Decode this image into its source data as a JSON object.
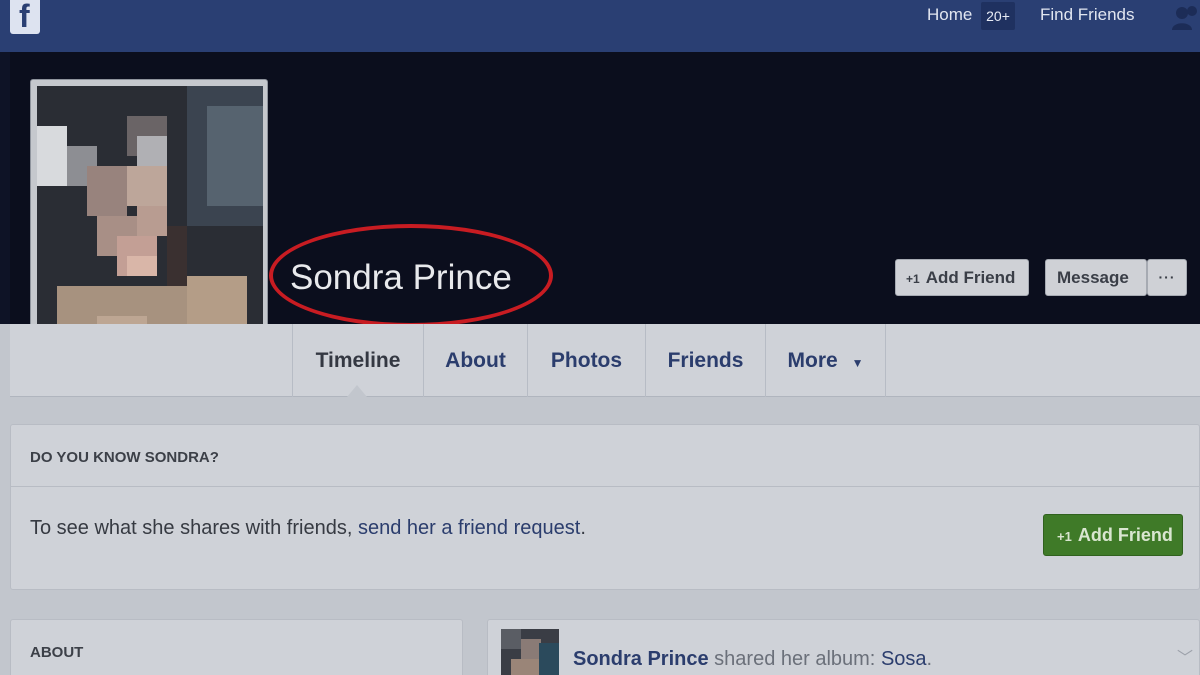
{
  "topbar": {
    "logo": "f",
    "home_label": "Home",
    "home_count": "20+",
    "find_friends_label": "Find Friends"
  },
  "profile": {
    "name": "Sondra Prince"
  },
  "cover_buttons": {
    "add_friend_plus": "+1",
    "add_friend_label": "Add Friend",
    "message_label": "Message",
    "more_label": "···"
  },
  "tabs": [
    {
      "label": "Timeline"
    },
    {
      "label": "About"
    },
    {
      "label": "Photos"
    },
    {
      "label": "Friends"
    },
    {
      "label": "More"
    }
  ],
  "know_card": {
    "title": "DO YOU KNOW SONDRA?",
    "text": "To see what she shares with friends, ",
    "link": "send her a friend request",
    "text_end": ".",
    "button_plus": "+1",
    "button_label": "Add Friend"
  },
  "about_card": {
    "title": "ABOUT"
  },
  "post": {
    "author": "Sondra Prince",
    "action": " shared her album: ",
    "album": "Sosa",
    "end": "."
  },
  "colors": {
    "topbar": "#2a3f73",
    "cover": "#0b0e1d",
    "highlight_circle": "#c81c22",
    "add_friend_green": "#3f7a28",
    "link": "#2b3d6d"
  }
}
